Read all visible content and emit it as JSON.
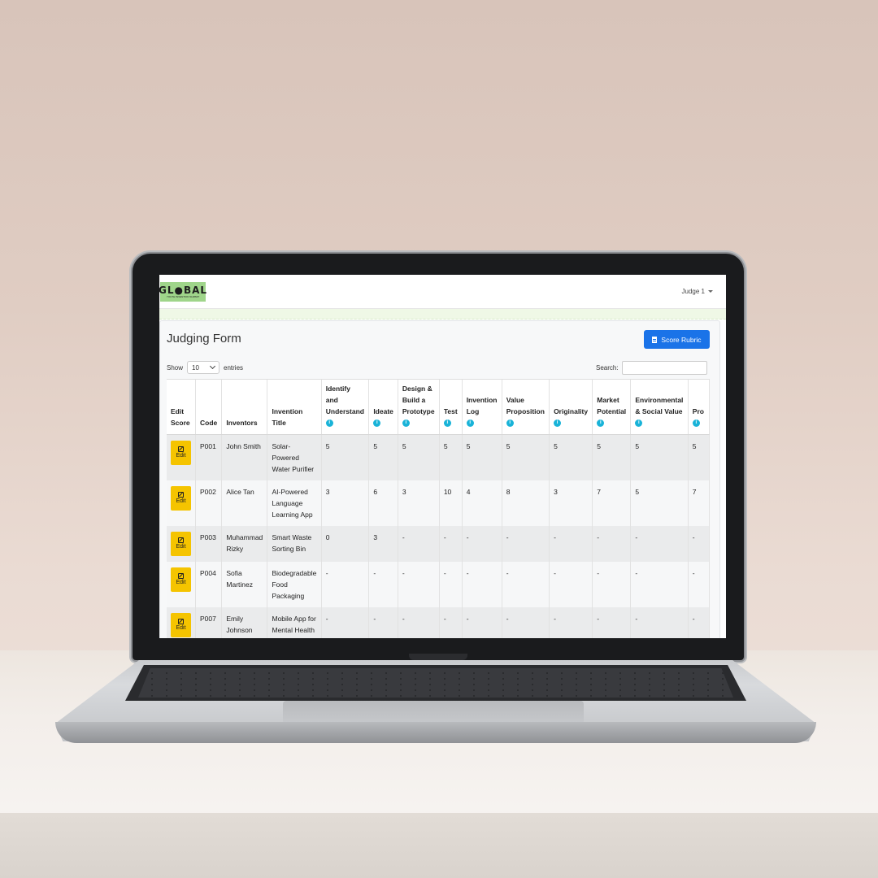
{
  "app": {
    "logo_text": "GL●BAL",
    "logo_sub": "YOUTH INVENTION SUMMIT",
    "user_menu": "Judge 1"
  },
  "page": {
    "title": "Judging Form",
    "rubric_button": "Score Rubric",
    "show_label": "Show",
    "entries_value": "10",
    "entries_label": "entries",
    "search_label": "Search:",
    "search_value": ""
  },
  "table": {
    "headers": [
      "Edit Score",
      "Code",
      "Inventors",
      "Invention Title",
      "Identify and Understand",
      "Ideate",
      "Design & Build a Prototype",
      "Test",
      "Invention Log",
      "Value Proposition",
      "Originality",
      "Market Potential",
      "Environmental & Social Value",
      "Pro"
    ],
    "edit_label": "Edit",
    "rows": [
      {
        "code": "P001",
        "inventors": "John Smith",
        "title": "Solar-Powered Water Purifier",
        "scores": [
          "5",
          "5",
          "5",
          "5",
          "5",
          "5",
          "5",
          "5",
          "5",
          "5"
        ]
      },
      {
        "code": "P002",
        "inventors": "Alice Tan",
        "title": "AI-Powered Language Learning App",
        "scores": [
          "3",
          "6",
          "3",
          "10",
          "4",
          "8",
          "3",
          "7",
          "5",
          "7"
        ]
      },
      {
        "code": "P003",
        "inventors": "Muhammad Rizky",
        "title": "Smart Waste Sorting Bin",
        "scores": [
          "0",
          "3",
          "-",
          "-",
          "-",
          "-",
          "-",
          "-",
          "-",
          "-"
        ]
      },
      {
        "code": "P004",
        "inventors": "Sofia Martinez",
        "title": "Biodegradable Food Packaging",
        "scores": [
          "-",
          "-",
          "-",
          "-",
          "-",
          "-",
          "-",
          "-",
          "-",
          "-"
        ]
      },
      {
        "code": "P007",
        "inventors": "Emily Johnson",
        "title": "Mobile App for Mental Health Awareness",
        "scores": [
          "-",
          "-",
          "-",
          "-",
          "-",
          "-",
          "-",
          "-",
          "-",
          "-"
        ]
      }
    ]
  }
}
